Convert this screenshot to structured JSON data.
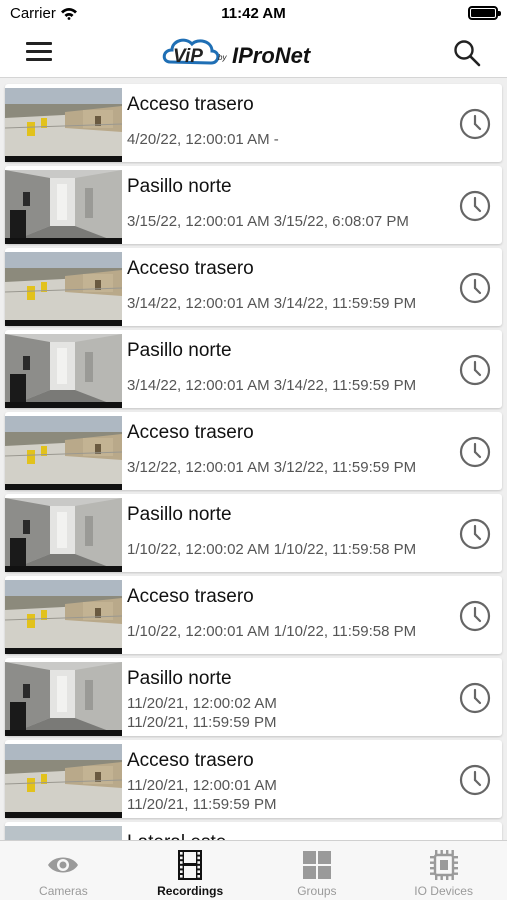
{
  "status_bar": {
    "carrier": "Carrier",
    "time": "11:42 AM"
  },
  "header": {
    "logo_text": "ViP by IProNet"
  },
  "recordings": [
    {
      "title": "Acceso trasero",
      "line1": "4/20/22, 12:00:01 AM -",
      "line2": "",
      "camera": "rear"
    },
    {
      "title": "Pasillo norte",
      "line1": "3/15/22, 12:00:01 AM 3/15/22, 6:08:07 PM",
      "line2": "",
      "camera": "hall"
    },
    {
      "title": "Acceso trasero",
      "line1": "3/14/22, 12:00:01 AM 3/14/22, 11:59:59 PM",
      "line2": "",
      "camera": "rear"
    },
    {
      "title": "Pasillo norte",
      "line1": "3/14/22, 12:00:01 AM 3/14/22, 11:59:59 PM",
      "line2": "",
      "camera": "hall"
    },
    {
      "title": "Acceso trasero",
      "line1": "3/12/22, 12:00:01 AM 3/12/22, 11:59:59 PM",
      "line2": "",
      "camera": "rear"
    },
    {
      "title": "Pasillo norte",
      "line1": "1/10/22, 12:00:02 AM 1/10/22, 11:59:58 PM",
      "line2": "",
      "camera": "hall"
    },
    {
      "title": "Acceso trasero",
      "line1": "1/10/22, 12:00:01 AM 1/10/22, 11:59:58 PM",
      "line2": "",
      "camera": "rear"
    },
    {
      "title": "Pasillo norte",
      "line1": "11/20/21, 12:00:02 AM",
      "line2": "11/20/21, 11:59:59 PM",
      "camera": "hall"
    },
    {
      "title": "Acceso trasero",
      "line1": "11/20/21, 12:00:01 AM",
      "line2": "11/20/21, 11:59:59 PM",
      "camera": "rear"
    },
    {
      "title": "Lateral este",
      "line1": "",
      "line2": "",
      "camera": "side"
    }
  ],
  "tabs": [
    {
      "label": "Cameras",
      "icon": "eye-icon",
      "active": false
    },
    {
      "label": "Recordings",
      "icon": "film-icon",
      "active": true
    },
    {
      "label": "Groups",
      "icon": "grid-icon",
      "active": false
    },
    {
      "label": "IO Devices",
      "icon": "chip-icon",
      "active": false
    }
  ],
  "colors": {
    "logo_blue": "#1f6fb5",
    "active_tab": "#111111",
    "inactive_tab": "#9a9a9a"
  }
}
